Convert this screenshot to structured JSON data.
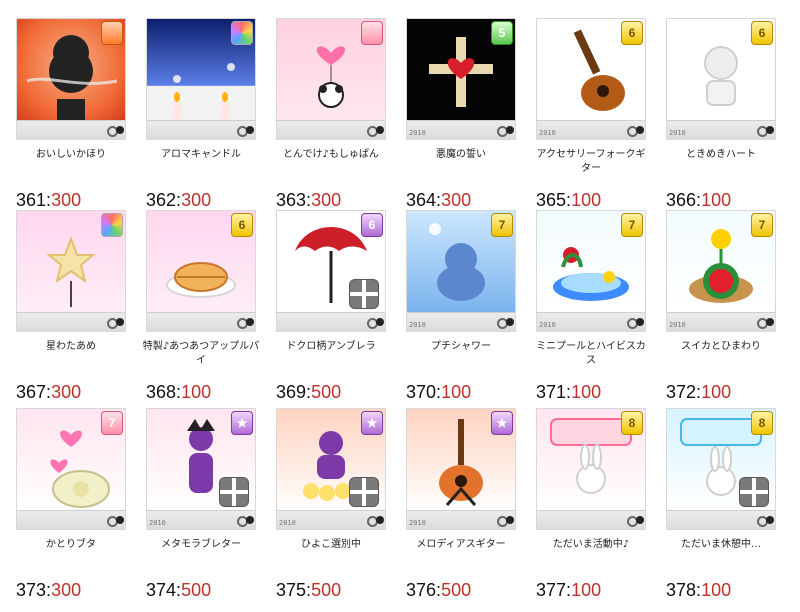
{
  "items": [
    {
      "name": "おいしいかほり",
      "code": "361",
      "value": "300",
      "badge": "",
      "badge_icon": "pie-icon",
      "bg": "bg-red",
      "year": ""
    },
    {
      "name": "アロマキャンドル",
      "code": "362",
      "value": "300",
      "badge": "",
      "badge_icon": "multicolor-icon",
      "bg": "bg-navy",
      "year": ""
    },
    {
      "name": "とんでけ♪もしゅぱん",
      "code": "363",
      "value": "300",
      "badge": "",
      "badge_icon": "card-icon",
      "bg": "bg-pink",
      "year": ""
    },
    {
      "name": "悪魔の誓い",
      "code": "364",
      "value": "300",
      "badge": "5",
      "badge_icon": "level-5-icon",
      "bg": "bg-black",
      "year": "2010"
    },
    {
      "name": "アクセサリーフォークギター",
      "code": "365",
      "value": "100",
      "badge": "6",
      "badge_icon": "level-6-icon",
      "bg": "bg-white",
      "year": "2010"
    },
    {
      "name": "ときめきハート",
      "code": "366",
      "value": "100",
      "badge": "6",
      "badge_icon": "level-6-icon",
      "bg": "bg-white",
      "year": "2010"
    },
    {
      "name": "星わたあめ",
      "code": "367",
      "value": "300",
      "badge": "",
      "badge_icon": "multicolor-icon",
      "bg": "bg-pink2",
      "year": ""
    },
    {
      "name": "特製♪あつあつアップルパイ",
      "code": "368",
      "value": "100",
      "badge": "6",
      "badge_icon": "level-6-icon",
      "bg": "bg-pink2",
      "year": ""
    },
    {
      "name": "ドクロ柄アンブレラ",
      "code": "369",
      "value": "500",
      "badge": "6",
      "badge_icon": "level-6-icon",
      "bg": "bg-white",
      "year": ""
    },
    {
      "name": "プチシャワー",
      "code": "370",
      "value": "100",
      "badge": "7",
      "badge_icon": "level-7-icon",
      "bg": "bg-sky",
      "year": "2010"
    },
    {
      "name": "ミニプールとハイビスカス",
      "code": "371",
      "value": "100",
      "badge": "7",
      "badge_icon": "level-7-icon",
      "bg": "bg-mint",
      "year": "2010"
    },
    {
      "name": "スイカとひまわり",
      "code": "372",
      "value": "100",
      "badge": "7",
      "badge_icon": "level-7-icon",
      "bg": "bg-mint",
      "year": "2010"
    },
    {
      "name": "かとりブタ",
      "code": "373",
      "value": "300",
      "badge": "7",
      "badge_icon": "level-7-icon",
      "bg": "bg-pinkwhite",
      "year": ""
    },
    {
      "name": "メタモラブレター",
      "code": "374",
      "value": "500",
      "badge": "★",
      "badge_icon": "star-icon",
      "bg": "bg-pinkwhite",
      "year": "2010"
    },
    {
      "name": "ひよこ選別中",
      "code": "375",
      "value": "500",
      "badge": "★",
      "badge_icon": "star-icon",
      "bg": "bg-orange",
      "year": "2010"
    },
    {
      "name": "メロディアスギター",
      "code": "376",
      "value": "500",
      "badge": "★",
      "badge_icon": "star-icon",
      "bg": "bg-orange",
      "year": "2010"
    },
    {
      "name": "ただいま活動中♪",
      "code": "377",
      "value": "100",
      "badge": "8",
      "badge_icon": "level-8-icon",
      "bg": "bg-pinkwhite",
      "year": ""
    },
    {
      "name": "ただいま休憩中…",
      "code": "378",
      "value": "100",
      "badge": "8",
      "badge_icon": "level-8-icon",
      "bg": "bg-bluewhite",
      "year": ""
    }
  ],
  "colors": {
    "value": "#c0302a",
    "code": "#111111",
    "name": "#222222"
  }
}
